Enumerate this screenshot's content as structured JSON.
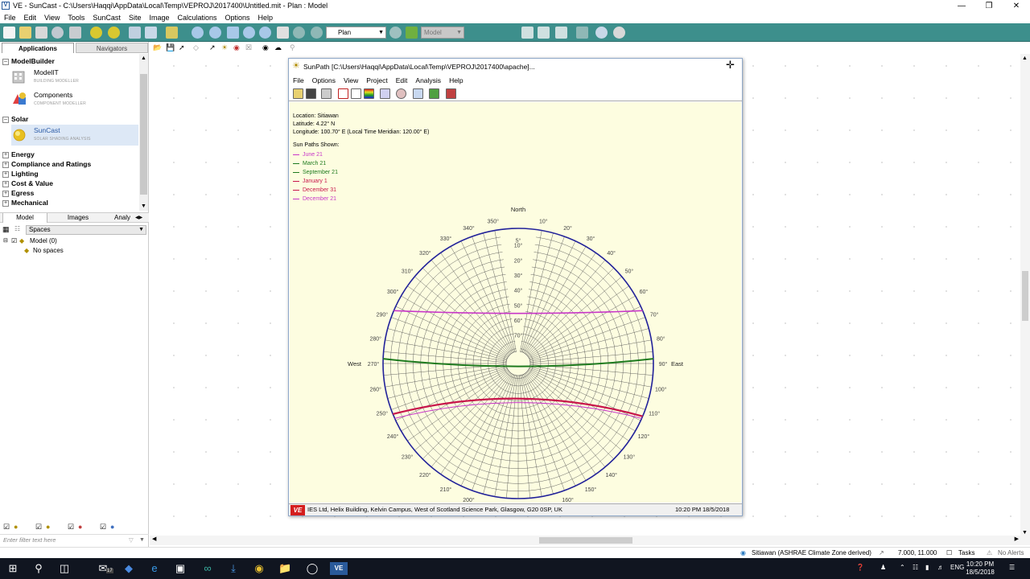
{
  "window": {
    "title": "VE - SunCast - C:\\Users\\Haqqi\\AppData\\Local\\Temp\\VEPROJ\\2017400\\Untitled.mit - Plan : Model",
    "icon_text": "V"
  },
  "menu": [
    "File",
    "Edit",
    "View",
    "Tools",
    "SunCast",
    "Site",
    "Image",
    "Calculations",
    "Options",
    "Help"
  ],
  "toolbar": {
    "view_select": "Plan",
    "model_select": "Model"
  },
  "left_tabs": {
    "applications": "Applications",
    "navigators": "Navigators"
  },
  "app_tree": {
    "modelbuilder": "ModelBuilder",
    "modelit": {
      "name": "ModelIT",
      "sub": "BUILDING MODELLER"
    },
    "components": {
      "name": "Components",
      "sub": "COMPONENT MODELLER"
    },
    "solar": "Solar",
    "suncast": {
      "name": "SunCast",
      "sub": "SOLAR SHADING ANALYSIS"
    },
    "categories": [
      "Energy",
      "Compliance and Ratings",
      "Lighting",
      "Cost & Value",
      "Egress",
      "Mechanical"
    ]
  },
  "sub_tabs": {
    "model": "Model",
    "images": "Images",
    "analysis": "Analy"
  },
  "spaces_select": "Spaces",
  "model_tree": {
    "root": "Model (0)",
    "child": "No spaces"
  },
  "filter_placeholder": "Enter filter text here",
  "statusbar": {
    "location": "Sitiawan (ASHRAE Climate Zone derived)",
    "coords": "7.000, 11.000",
    "tasks": "Tasks",
    "alerts": "No Alerts"
  },
  "taskbar": {
    "time": "10:20 PM",
    "date": "18/5/2018",
    "lang": "ENG",
    "mail_badge": "17"
  },
  "sunpath": {
    "title": "SunPath [C:\\Users\\Haqqi\\AppData\\Local\\Temp\\VEPROJ\\2017400\\apache]...",
    "menu": [
      "File",
      "Options",
      "View",
      "Project",
      "Edit",
      "Analysis",
      "Help"
    ],
    "location": "Location: Sitiawan",
    "latitude": "Latitude: 4.22° N",
    "longitude": "Longitude: 100.70° E (Local Time Meridian: 120.00° E)",
    "shown_label": "Sun Paths Shown:",
    "legend": [
      {
        "label": "June 21",
        "color": "#c837c8"
      },
      {
        "label": "March 21",
        "color": "#1e7a1e"
      },
      {
        "label": "September 21",
        "color": "#1e7a1e"
      },
      {
        "label": "January 1",
        "color": "#c8164b"
      },
      {
        "label": "December 31",
        "color": "#c8164b"
      },
      {
        "label": "December 21",
        "color": "#c837c8"
      }
    ],
    "compass": {
      "north": "North",
      "south": "South",
      "east": "East",
      "west": "West"
    },
    "status_text": "IES Ltd, Helix Building, Kelvin Campus, West of Scotland Science Park, Glasgow, G20 0SP, UK",
    "status_time": "10:20 PM",
    "status_date": "18/5/2018",
    "logo": "VE",
    "azimuth_labels": [
      "10°",
      "20°",
      "30°",
      "40°",
      "50°",
      "60°",
      "70°",
      "80°",
      "90°",
      "100°",
      "110°",
      "120°",
      "130°",
      "140°",
      "150°",
      "160°",
      "170°",
      "180°",
      "190°",
      "200°",
      "210°",
      "220°",
      "230°",
      "240°",
      "250°",
      "260°",
      "270°",
      "280°",
      "290°",
      "300°",
      "310°",
      "320°",
      "330°",
      "340°",
      "350°"
    ],
    "altitude_labels": [
      "5°",
      "10°",
      "20°",
      "30°",
      "40°",
      "50°",
      "60°",
      "70°"
    ]
  }
}
